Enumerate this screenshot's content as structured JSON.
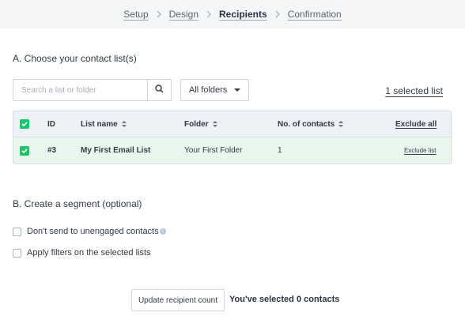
{
  "stepper": {
    "steps": [
      {
        "label": "Setup"
      },
      {
        "label": "Design"
      },
      {
        "label": "Recipients",
        "active": true
      },
      {
        "label": "Confirmation"
      }
    ]
  },
  "section_a": {
    "title": "A. Choose your contact list(s)",
    "search_placeholder": "Search a list or folder",
    "search_value": "",
    "folder_filter": "All folders",
    "selected_count": "1 selected list"
  },
  "table": {
    "headers": {
      "id": "ID",
      "list_name": "List name",
      "folder": "Folder",
      "contacts": "No. of contacts",
      "exclude_all": "Exclude all"
    },
    "rows": [
      {
        "checked": true,
        "id": "#3",
        "list_name": "My First Email List",
        "folder": "Your First Folder",
        "contacts": "1",
        "action": "Exclude list"
      }
    ]
  },
  "section_b": {
    "title": "B. Create a segment (optional)",
    "option_unengaged": "Don't send to unengaged contacts",
    "option_filters": "Apply filters on the selected lists"
  },
  "footer": {
    "update_button": "Update recipient count",
    "selected_text": "You've selected 0 contacts"
  },
  "colors": {
    "accent_green": "#1ec26b",
    "selected_row": "#e8f7ee",
    "header_bg": "#edf0f4"
  },
  "icons": {
    "search": "search-icon",
    "chevron": "chevron-right-icon",
    "caret": "caret-down-icon",
    "sort": "sort-icon",
    "check": "check-icon",
    "info": "info-icon"
  }
}
